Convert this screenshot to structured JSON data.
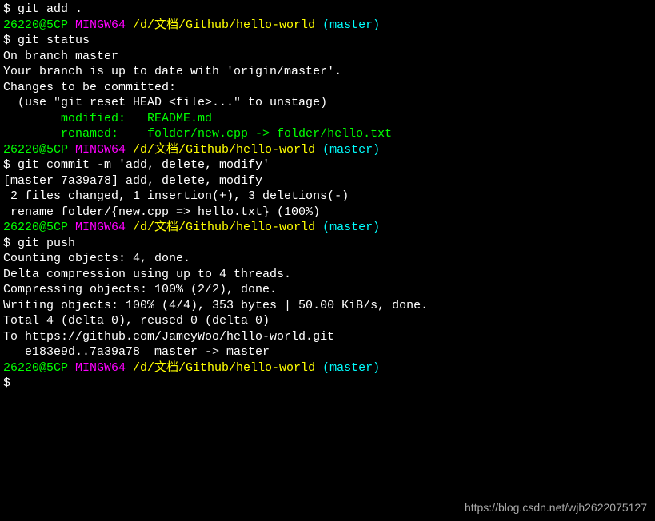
{
  "lines": {
    "cmd1_prompt": "$ ",
    "cmd1": "git add .",
    "blank": "",
    "p1_user": "26220@5CP",
    "p1_sys": " MINGW64",
    "p1_path": " /d/文档/Github/hello-world",
    "p1_branch": " (master)",
    "cmd2_prompt": "$ ",
    "cmd2": "git status",
    "out2_1": "On branch master",
    "out2_2": "Your branch is up to date with 'origin/master'.",
    "out2_3": "Changes to be committed:",
    "out2_4": "  (use \"git reset HEAD <file>...\" to unstage)",
    "out2_5": "        modified:   README.md",
    "out2_6": "        renamed:    folder/new.cpp -> folder/hello.txt",
    "cmd3_prompt": "$ ",
    "cmd3": "git commit -m 'add, delete, modify'",
    "out3_1": "[master 7a39a78] add, delete, modify",
    "out3_2": " 2 files changed, 1 insertion(+), 3 deletions(-)",
    "out3_3": " rename folder/{new.cpp => hello.txt} (100%)",
    "cmd4_prompt": "$ ",
    "cmd4": "git push",
    "out4_1": "Counting objects: 4, done.",
    "out4_2": "Delta compression using up to 4 threads.",
    "out4_3": "Compressing objects: 100% (2/2), done.",
    "out4_4": "Writing objects: 100% (4/4), 353 bytes | 50.00 KiB/s, done.",
    "out4_5": "Total 4 (delta 0), reused 0 (delta 0)",
    "out4_6": "To https://github.com/JameyWoo/hello-world.git",
    "out4_7": "   e183e9d..7a39a78  master -> master",
    "cmd5_prompt": "$ "
  },
  "watermark": "https://blog.csdn.net/wjh2622075127"
}
